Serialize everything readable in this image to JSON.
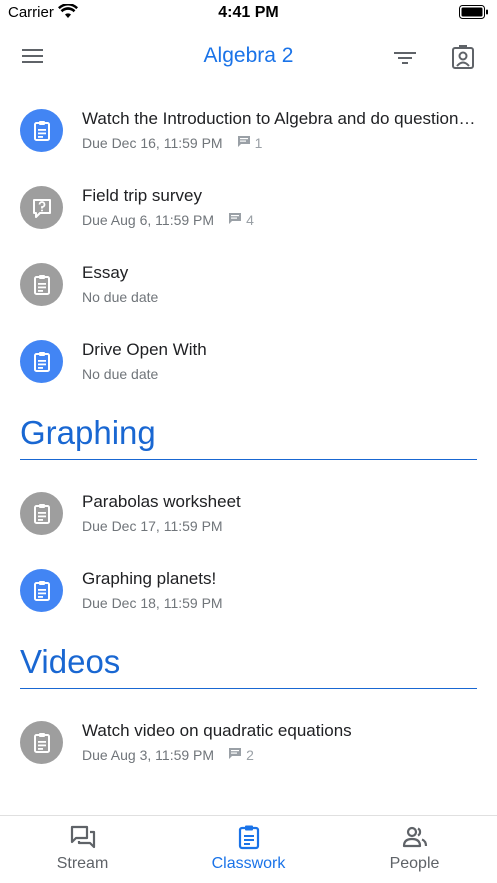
{
  "status_bar": {
    "carrier": "Carrier",
    "time": "4:41 PM",
    "icons": [
      "wifi-icon",
      "battery-icon"
    ]
  },
  "app_bar": {
    "title": "Algebra 2",
    "icons": [
      "menu-icon",
      "filter-icon",
      "profile-icon"
    ]
  },
  "items_top": [
    {
      "title": "Watch the Introduction to Algebra and do question…",
      "due": "Due Dec 16, 11:59 PM",
      "comments": "1",
      "icon": "assignment-icon",
      "color": "#4285f4"
    },
    {
      "title": "Field trip survey",
      "due": "Due Aug 6, 11:59 PM",
      "comments": "4",
      "icon": "question-icon",
      "color": "#9e9e9e"
    },
    {
      "title": "Essay",
      "due": "No due date",
      "icon": "assignment-icon",
      "color": "#9e9e9e"
    },
    {
      "title": "Drive Open With",
      "due": "No due date",
      "icon": "assignment-icon",
      "color": "#4285f4"
    }
  ],
  "sections": [
    {
      "title": "Graphing",
      "items": [
        {
          "title": "Parabolas worksheet",
          "due": "Due Dec 17, 11:59 PM",
          "icon": "assignment-icon",
          "color": "#9e9e9e"
        },
        {
          "title": "Graphing planets!",
          "due": "Due Dec 18, 11:59 PM",
          "icon": "assignment-icon",
          "color": "#4285f4"
        }
      ]
    },
    {
      "title": "Videos",
      "items": [
        {
          "title": "Watch video on quadratic equations",
          "due": "Due Aug 3, 11:59 PM",
          "comments": "2",
          "icon": "assignment-icon",
          "color": "#9e9e9e"
        }
      ]
    }
  ],
  "bottom_nav": [
    {
      "label": "Stream",
      "icon": "stream-icon",
      "active": false
    },
    {
      "label": "Classwork",
      "icon": "classwork-icon",
      "active": true
    },
    {
      "label": "People",
      "icon": "people-icon",
      "active": false
    }
  ],
  "colors": {
    "accent": "#1a73e8",
    "assigned_blue": "#4285f4",
    "neutral_grey": "#9e9e9e"
  }
}
